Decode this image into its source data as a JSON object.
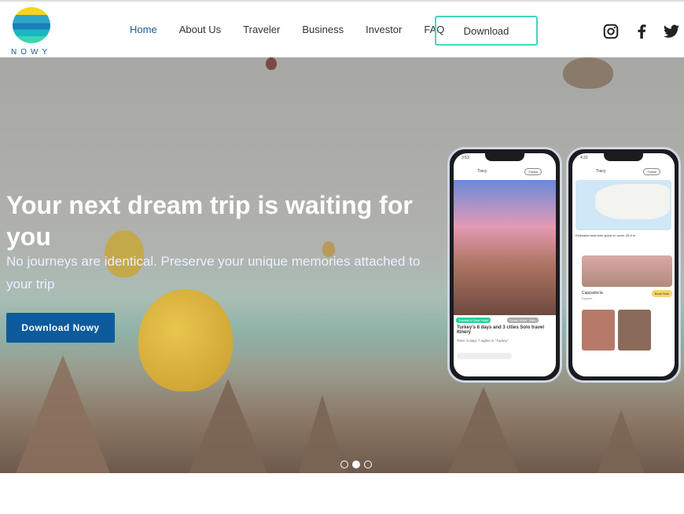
{
  "brand": {
    "name": "NOWY"
  },
  "nav": {
    "items": [
      "Home",
      "About Us",
      "Traveler",
      "Business",
      "Investor",
      "FAQ"
    ],
    "active": "Home",
    "download": "Download"
  },
  "social": [
    "instagram-icon",
    "facebook-icon",
    "twitter-icon"
  ],
  "hero": {
    "title": "Your next dream trip is waiting for you",
    "subtitle": "No journeys are identical. Preserve your unique memories attached to your trip",
    "cta": "Download Nowy"
  },
  "phone1": {
    "time": "3:53",
    "user": "Tracy",
    "follow": "Follow",
    "tag1": "Traveler's Cave Hotel",
    "tag2": "Sultan Hotel - Baku",
    "title": "Turkey's 8 days and 3 cities Solo travel Itinery",
    "meta": "Time: 8 days 7 nights in \"Turkey\""
  },
  "phone2": {
    "time": "4:31",
    "user": "Tracy",
    "follow": "Follow",
    "estimate": "Estimated total time spent on route: 35.9 hr",
    "place": "Cappadocia",
    "region": "Kayseri",
    "book": "Book Now"
  },
  "carousel": {
    "slides": 3,
    "active": 2
  },
  "colors": {
    "accent": "#3fd9bd",
    "primary": "#0d5b9c",
    "nav_active": "#1d5c8f"
  }
}
